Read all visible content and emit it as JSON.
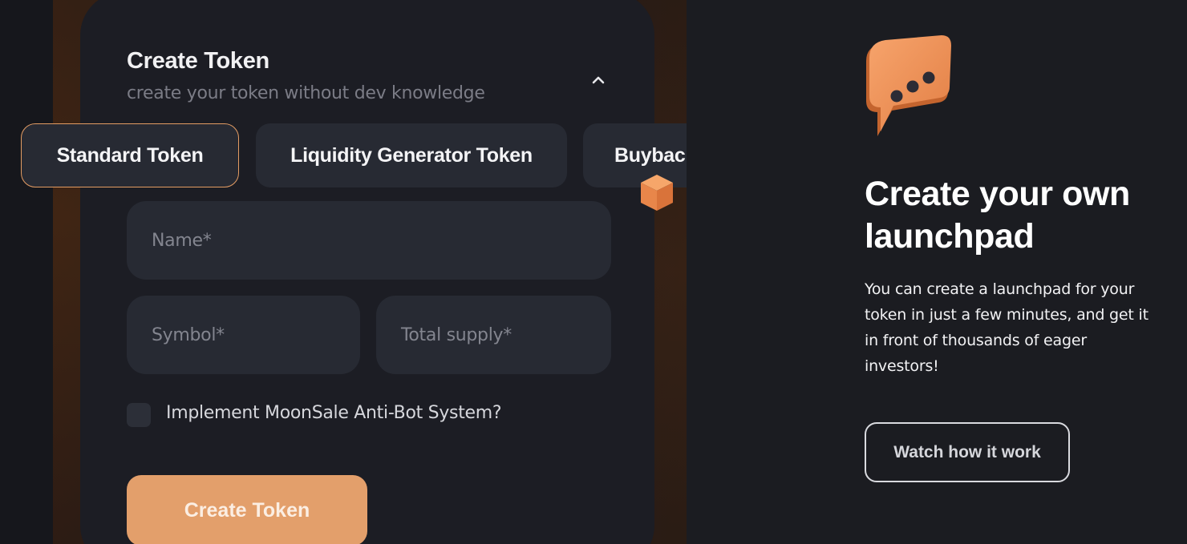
{
  "form": {
    "title": "Create Token",
    "subtitle": "create your token without dev knowledge",
    "tabs": [
      {
        "label": "Standard Token",
        "selected": true
      },
      {
        "label": "Liquidity Generator Token",
        "selected": false
      },
      {
        "label": "Buybac",
        "selected": false
      }
    ],
    "fields": {
      "name_placeholder": "Name*",
      "symbol_placeholder": "Symbol*",
      "supply_placeholder": "Total supply*"
    },
    "antibot_label": "Implement MoonSale Anti-Bot System?",
    "antibot_checked": false,
    "submit_label": "Create Token"
  },
  "promo": {
    "icon": "chat-bubble-icon",
    "headline": "Create your own launchpad",
    "description": "You can create a launchpad for your token in just a few minutes, and get it in front of thousands of eager investors!",
    "cta_label": "Watch how it work"
  },
  "colors": {
    "background": "#1b1c21",
    "card": "#1c1d24",
    "field": "#272a33",
    "accent": "#e39f6b",
    "accent_border": "#e39c63"
  }
}
